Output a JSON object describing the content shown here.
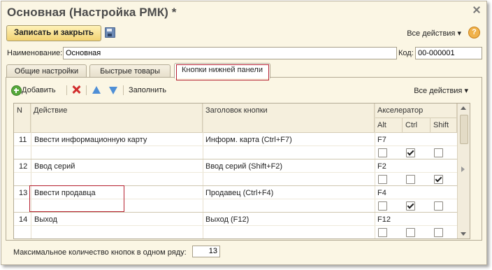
{
  "window": {
    "title": "Основная (Настройка РМК) *"
  },
  "toolbar": {
    "save_close_label": "Записать и закрыть",
    "all_actions_label": "Все действия",
    "help_label": "?"
  },
  "form": {
    "name_label": "Наименование:",
    "name_value": "Основная",
    "code_label": "Код:",
    "code_value": "00-000001"
  },
  "tabs": [
    {
      "label": "Общие настройки"
    },
    {
      "label": "Быстрые товары"
    },
    {
      "label": "Кнопки нижней панели",
      "active": true
    }
  ],
  "table_toolbar": {
    "add_label": "Добавить",
    "fill_label": "Заполнить",
    "all_actions_label": "Все действия"
  },
  "table": {
    "headers": {
      "n": "N",
      "action": "Действие",
      "button_title": "Заголовок кнопки",
      "accelerator": "Акселератор",
      "alt": "Alt",
      "ctrl": "Ctrl",
      "shift": "Shift"
    },
    "rows": [
      {
        "n": "11",
        "action": "Ввести информационную карту",
        "title": "Информ. карта (Ctrl+F7)",
        "key": "F7",
        "alt": false,
        "ctrl": true,
        "shift": false
      },
      {
        "n": "12",
        "action": "Ввод серий",
        "title": "Ввод серий (Shift+F2)",
        "key": "F2",
        "alt": false,
        "ctrl": false,
        "shift": true
      },
      {
        "n": "13",
        "action": "Ввести продавца",
        "title": "Продавец (Ctrl+F4)",
        "key": "F4",
        "alt": false,
        "ctrl": true,
        "shift": false
      },
      {
        "n": "14",
        "action": "Выход",
        "title": "Выход (F12)",
        "key": "F12",
        "alt": false,
        "ctrl": false,
        "shift": false
      }
    ]
  },
  "footer": {
    "max_buttons_label": "Максимальное количество кнопок в одном ряду:",
    "max_buttons_value": "13"
  },
  "colors": {
    "accent": "#b51f2e",
    "background": "#fbf6e4",
    "button": "#f2d272"
  }
}
